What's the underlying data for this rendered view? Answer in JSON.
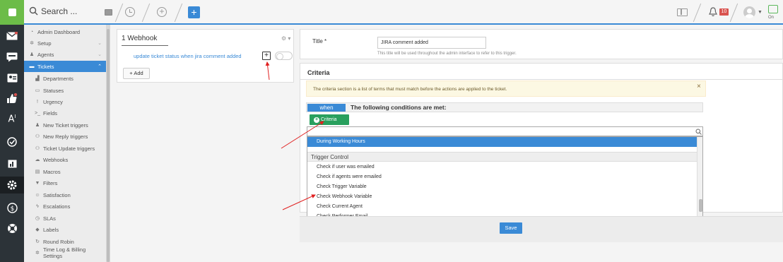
{
  "topbar": {
    "search_placeholder": "Search ...",
    "notification_count": "10",
    "chat_status": "On"
  },
  "sidebar": {
    "items": [
      {
        "label": "Admin Dashboard",
        "icon": "dashboard-icon"
      },
      {
        "label": "Setup",
        "icon": "gear-icon"
      },
      {
        "label": "Agents",
        "icon": "person-icon"
      },
      {
        "label": "Tickets",
        "icon": "ticket-icon"
      },
      {
        "label": "Departments",
        "icon": "building-icon"
      },
      {
        "label": "Statuses",
        "icon": "status-icon"
      },
      {
        "label": "Urgency",
        "icon": "exclamation-icon"
      },
      {
        "label": "Fields",
        "icon": "terminal-icon"
      },
      {
        "label": "New Ticket triggers",
        "icon": "person-icon"
      },
      {
        "label": "New Reply triggers",
        "icon": "people-icon"
      },
      {
        "label": "Ticket Update triggers",
        "icon": "people-icon"
      },
      {
        "label": "Webhooks",
        "icon": "cloud-icon"
      },
      {
        "label": "Macros",
        "icon": "keyboard-icon"
      },
      {
        "label": "Filters",
        "icon": "filter-icon"
      },
      {
        "label": "Satisfaction",
        "icon": "smile-icon"
      },
      {
        "label": "Escalations",
        "icon": "bolt-icon"
      },
      {
        "label": "SLAs",
        "icon": "clock-icon"
      },
      {
        "label": "Labels",
        "icon": "tag-icon"
      },
      {
        "label": "Round Robin",
        "icon": "refresh-icon"
      },
      {
        "label": "Time Log & Billing Settings",
        "icon": "gear-icon"
      }
    ]
  },
  "middle": {
    "title": "1 Webhook",
    "trigger_link": "update ticket status when jira comment added",
    "add_label": "+ Add"
  },
  "form": {
    "title_label": "Title *",
    "title_value": "JIRA comment added",
    "title_help": "This title will be used throughout the admin interface to refer to this trigger.",
    "criteria_heading": "Criteria",
    "criteria_alert": "The criteria section is a list of terms that must match before the actions are applied to the ticket.",
    "when_badge": "when",
    "when_text": "The following conditions are met:",
    "criteria_button": "Criteria",
    "save_label": "Save"
  },
  "dropdown": {
    "selected_option": "During Working Hours",
    "group_label": "Trigger Control",
    "options": [
      "Check if user was emailed",
      "Check if agents were emailed",
      "Check Trigger Variable",
      "Check Webhook Variable",
      "Check Current Agent",
      "Check Performer Email"
    ]
  },
  "colors": {
    "accent": "#3a8ad6",
    "success": "#29a05e",
    "brand": "#6cbc48",
    "danger": "#d9534f"
  }
}
